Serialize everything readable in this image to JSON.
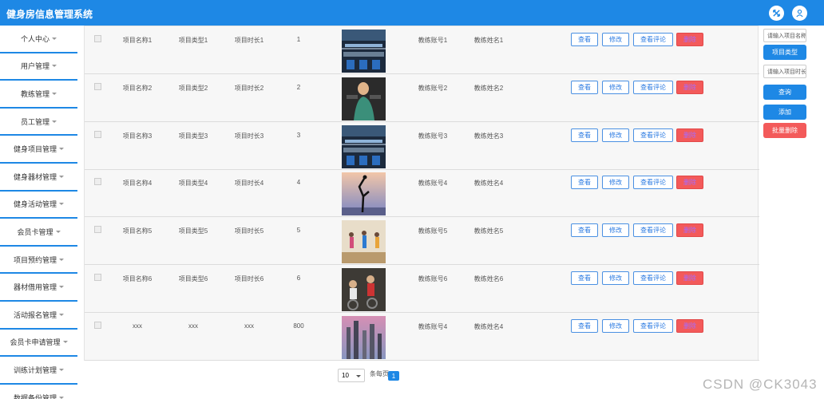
{
  "header": {
    "title": "健身房信息管理系统"
  },
  "sidebar": {
    "items": [
      {
        "label": "个人中心"
      },
      {
        "label": "用户管理"
      },
      {
        "label": "教练管理"
      },
      {
        "label": "员工管理"
      },
      {
        "label": "健身项目管理"
      },
      {
        "label": "健身器材管理"
      },
      {
        "label": "健身活动管理"
      },
      {
        "label": "会员卡管理"
      },
      {
        "label": "项目预约管理"
      },
      {
        "label": "器材借用管理"
      },
      {
        "label": "活动报名管理"
      },
      {
        "label": "会员卡申请管理"
      },
      {
        "label": "训练计划管理"
      },
      {
        "label": "数据备份管理"
      }
    ]
  },
  "table": {
    "rows": [
      {
        "name": "项目名称1",
        "type": "项目类型1",
        "duration": "项目时长1",
        "num": "1",
        "coach_account": "教练账号1",
        "coach_name": "教练姓名1",
        "img": "gym"
      },
      {
        "name": "项目名称2",
        "type": "项目类型2",
        "duration": "项目时长2",
        "num": "2",
        "coach_account": "教练账号2",
        "coach_name": "教练姓名2",
        "img": "workout"
      },
      {
        "name": "项目名称3",
        "type": "项目类型3",
        "duration": "项目时长3",
        "num": "3",
        "coach_account": "教练账号3",
        "coach_name": "教练姓名3",
        "img": "gym"
      },
      {
        "name": "项目名称4",
        "type": "项目类型4",
        "duration": "项目时长4",
        "num": "4",
        "coach_account": "教练账号4",
        "coach_name": "教练姓名4",
        "img": "yoga"
      },
      {
        "name": "项目名称5",
        "type": "项目类型5",
        "duration": "项目时长5",
        "num": "5",
        "coach_account": "教练账号5",
        "coach_name": "教练姓名5",
        "img": "class"
      },
      {
        "name": "项目名称6",
        "type": "项目类型6",
        "duration": "项目时长6",
        "num": "6",
        "coach_account": "教练账号6",
        "coach_name": "教练姓名6",
        "img": "cycle"
      },
      {
        "name": "xxx",
        "type": "xxx",
        "duration": "xxx",
        "num": "800",
        "coach_account": "教练账号4",
        "coach_name": "教练姓名4",
        "img": "city"
      }
    ],
    "actions": {
      "view": "查看",
      "edit": "修改",
      "comments": "查看评论",
      "delete": "删除"
    }
  },
  "right": {
    "search_name_placeholder": "请输入项目名称",
    "type_button": "项目类型",
    "search_coach_placeholder": "请输入项目时长",
    "query_button": "查询",
    "add_button": "添加",
    "batch_delete_button": "批量删除"
  },
  "pagination": {
    "page_size": "10",
    "per_page_label": "条每页",
    "current_page": "1"
  },
  "watermark": "CSDN @CK3043",
  "colors": {
    "primary": "#1e88e5",
    "danger": "#f35a5a"
  }
}
